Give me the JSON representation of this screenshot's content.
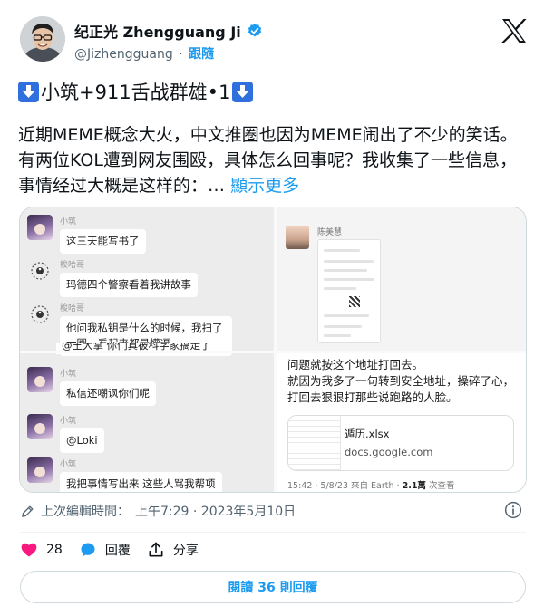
{
  "author": {
    "display_name": "纪正光 Zhengguang Ji",
    "handle": "@Jizhengguang",
    "separator": "·",
    "follow_label": "跟隨"
  },
  "tweet": {
    "title": "小筑+911舌战群雄•1",
    "body": "近期MEME概念大火，中文推圈也因为MEME闹出了不少的笑话。有两位KOL遭到网友围殴，具体怎么回事呢？我收集了一些信息，事情经过大概是这样的：…",
    "show_more": "顯示更多",
    "timestamp_prefix": "上次編輯時間：",
    "time": "上午7:29 · 2023年5月10日"
  },
  "media": {
    "chat": [
      {
        "sender": "小筑",
        "text": "这三天能写书了",
        "avatar": "anime"
      },
      {
        "sender": "梭哈哥",
        "text": "玛德四个警察看着我讲故事",
        "avatar": "taiji"
      },
      {
        "sender": "梭哈哥",
        "text": "他问我私钥是什么的时候，我扫了一圈，看起来都是懵逼",
        "avatar": "taiji"
      },
      {
        "sender": "小筑",
        "text": "私信还嘲讽你们呢",
        "avatar": "anime"
      },
      {
        "sender": "小筑",
        "text": "@Loki",
        "avatar": "anime"
      },
      {
        "sender": "小筑",
        "text": "我把事情写出来 这些人骂我帮项",
        "avatar": "anime"
      }
    ],
    "chat_cut_text": "@王大掌  你们真被科学家搞走了",
    "doc_pane_name": "陈美慧",
    "tweet_pane": {
      "line1": "问题就按这个地址打回去。",
      "line2": "就因为我多了一句转到安全地址，操碎了心，",
      "line3": "打回去狠狠打那些说跑路的人脸。",
      "file_name": "遁历.xlsx",
      "file_domain": "docs.google.com",
      "meta_prefix": "15:42 · 5/8/23 來自 Earth · ",
      "meta_count": "2.1萬",
      "meta_suffix": " 次查看"
    }
  },
  "actions": {
    "like_count": "28",
    "reply_label": "回覆",
    "share_label": "分享"
  },
  "read_replies_label": "閱讀 36 則回覆",
  "icons": {
    "verified": "verified-badge-icon",
    "logo": "x-logo-icon",
    "edit": "edit-pencil-icon",
    "info": "info-icon",
    "like": "heart-icon",
    "reply": "reply-bubble-icon",
    "share": "share-icon",
    "title_arrow": "down-arrow-emoji-icon"
  },
  "colors": {
    "accent": "#1d9bf0",
    "like": "#f91880",
    "emoji_box": "#2f6fde"
  }
}
